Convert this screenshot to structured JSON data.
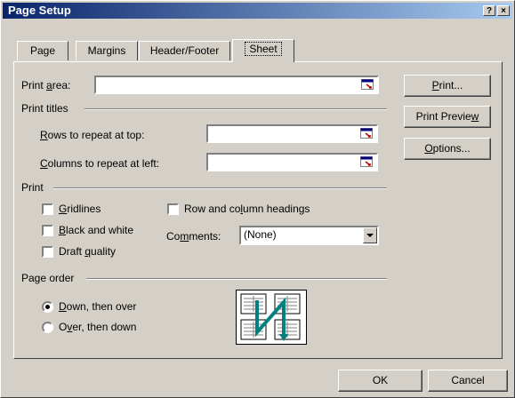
{
  "window": {
    "title": "Page Setup",
    "help_glyph": "?",
    "close_glyph": "×"
  },
  "tabs": [
    {
      "label": "Page",
      "active": false
    },
    {
      "label": "Margins",
      "active": false
    },
    {
      "label": "Header/Footer",
      "active": false
    },
    {
      "label": "Sheet",
      "active": true
    }
  ],
  "print_area": {
    "label_pre": "Print ",
    "label_u": "a",
    "label_post": "rea:",
    "value": ""
  },
  "print_titles": {
    "group_label": "Print titles",
    "rows": {
      "label_u": "R",
      "label_post": "ows to repeat at top:",
      "value": ""
    },
    "cols": {
      "label_u": "C",
      "label_post": "olumns to repeat at left:",
      "value": ""
    }
  },
  "print": {
    "group_label": "Print",
    "gridlines": {
      "label_u": "G",
      "label_post": "ridlines",
      "checked": false
    },
    "black_white": {
      "label_u": "B",
      "label_post": "lack and white",
      "checked": false
    },
    "draft": {
      "label_pre": "Draft ",
      "label_u": "q",
      "label_post": "uality",
      "checked": false
    },
    "row_col": {
      "label_pre": "Row and co",
      "label_u": "l",
      "label_post": "umn headings",
      "checked": false
    },
    "comments": {
      "label_pre": "Co",
      "label_u": "m",
      "label_post": "ments:",
      "value": "(None)"
    }
  },
  "page_order": {
    "group_label": "Page order",
    "down_over": {
      "label_u": "D",
      "label_post": "own, then over",
      "selected": true
    },
    "over_down": {
      "label_pre": "O",
      "label_u": "v",
      "label_post": "er, then down",
      "selected": false
    }
  },
  "side_buttons": {
    "print": {
      "label_u": "P",
      "label_post": "rint..."
    },
    "preview": {
      "label_pre": "Print Previe",
      "label_u": "w"
    },
    "options": {
      "label_u": "O",
      "label_post": "ptions..."
    }
  },
  "footer": {
    "ok": "OK",
    "cancel": "Cancel"
  },
  "colors": {
    "title_start": "#0a246a",
    "title_end": "#a6caf0",
    "face": "#d4d0c8",
    "icon_arrow": "#008080"
  }
}
